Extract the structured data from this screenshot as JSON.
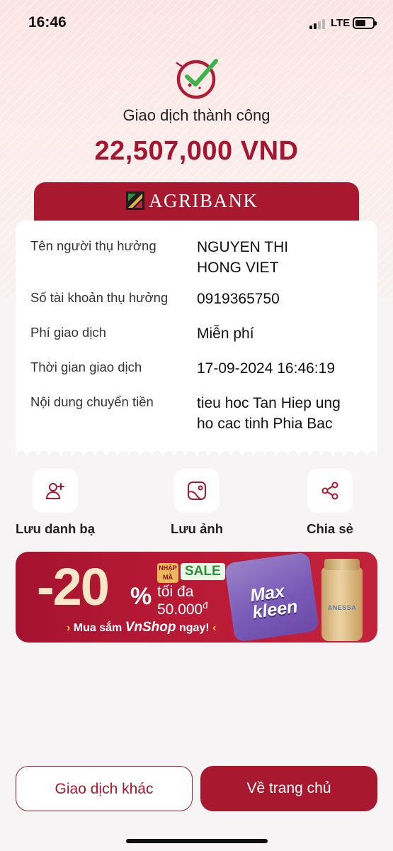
{
  "status_bar": {
    "time": "16:46",
    "network": "LTE"
  },
  "result": {
    "title": "Giao dịch thành công",
    "amount": "22,507,000 VND"
  },
  "bank": {
    "name": "AGRIBANK"
  },
  "details": [
    {
      "label": "Tên người thụ hưởng",
      "value": "NGUYEN THI HONG VIET"
    },
    {
      "label": "Số tài khoản thụ hưởng",
      "value": "0919365750"
    },
    {
      "label": "Phí giao dịch",
      "value": "Miễn phí"
    },
    {
      "label": "Thời gian giao dịch",
      "value": "17-09-2024 16:46:19"
    },
    {
      "label": "Nội dung chuyển tiền",
      "value": "tieu hoc Tan Hiep ung ho cac tinh Phia Bac"
    }
  ],
  "actions": {
    "save_contact": {
      "label": "Lưu danh bạ",
      "icon": "add-user-icon"
    },
    "save_image": {
      "label": "Lưu ảnh",
      "icon": "image-icon"
    },
    "share": {
      "label": "Chia sẻ",
      "icon": "share-icon"
    }
  },
  "promo": {
    "discount": "-20",
    "percent": "%",
    "code_label": "NHẬP MÃ",
    "sale_badge": "SALE",
    "max_text": "tối đa",
    "limit_value": "50.000",
    "limit_unit": "đ",
    "cta_prefix": "Mua sắm",
    "cta_brand": "VnShop",
    "cta_suffix": "ngay!",
    "product_one_text": "Max kleen",
    "product_two_text": "ANESSA"
  },
  "buttons": {
    "other_transaction": "Giao dịch khác",
    "go_home": "Về trang chủ"
  },
  "colors": {
    "brand": "#a8182e",
    "amount": "#a51530",
    "success_check": "#3cb44b"
  }
}
